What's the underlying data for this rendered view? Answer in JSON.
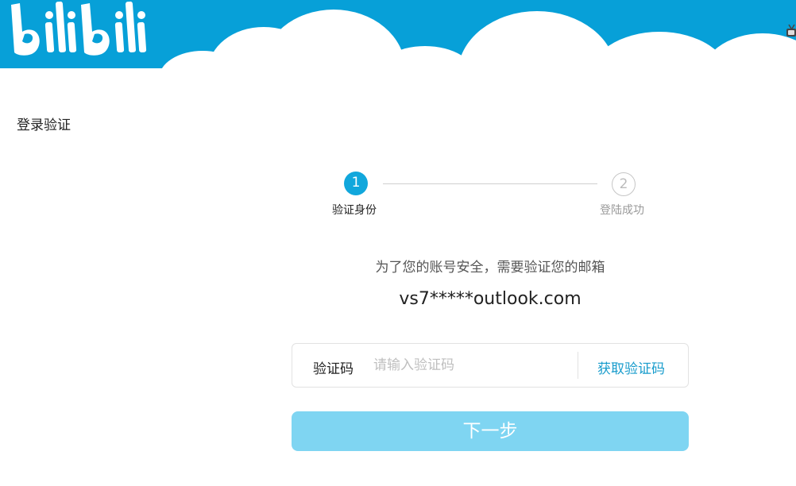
{
  "header": {
    "logo_text": "bilibili",
    "logo_icon": "bilibili-logo",
    "brand_color": "#07a0d8"
  },
  "page": {
    "title": "登录验证"
  },
  "steps": [
    {
      "number": "1",
      "label": "验证身份",
      "state": "active"
    },
    {
      "number": "2",
      "label": "登陆成功",
      "state": "pending"
    }
  ],
  "verification": {
    "message": "为了您的账号安全，需要验证您的邮箱",
    "email": "vs7*****outlook.com",
    "code_label": "验证码",
    "code_placeholder": "请输入验证码",
    "code_value": "",
    "get_code_label": "获取验证码"
  },
  "actions": {
    "next_label": "下一步",
    "next_color": "#7fd5f2"
  }
}
